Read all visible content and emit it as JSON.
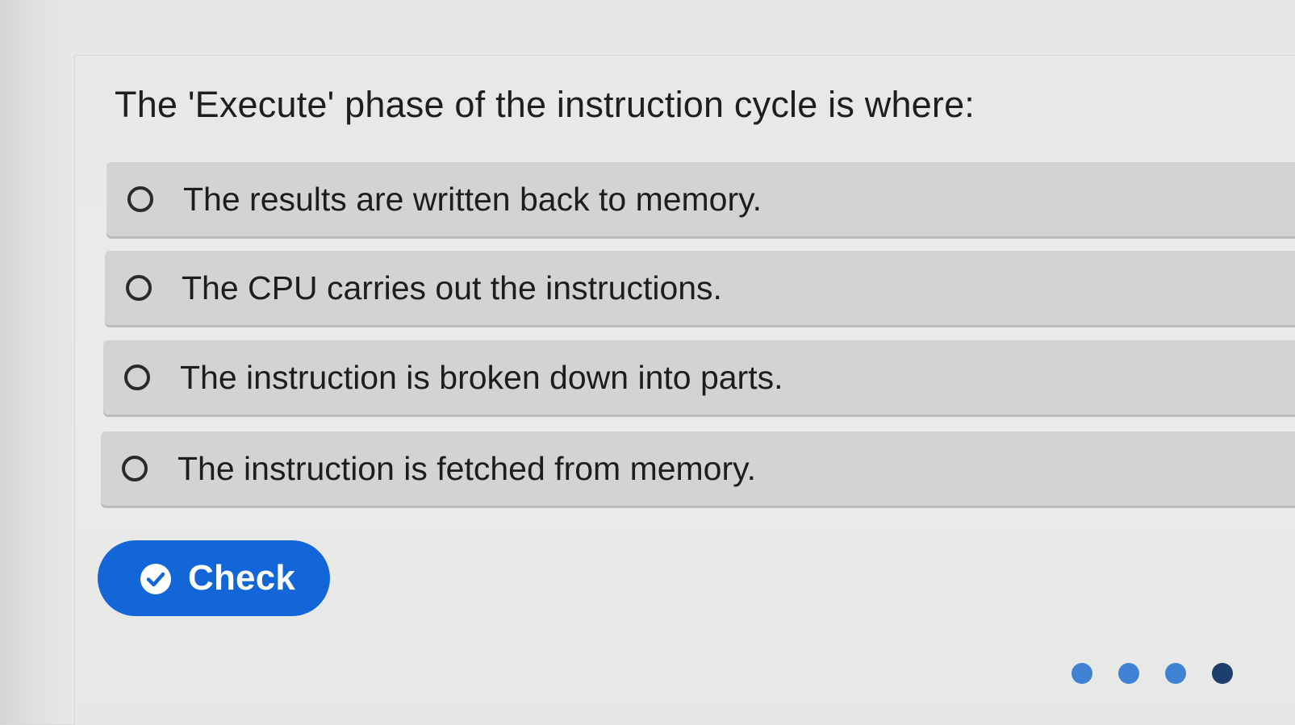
{
  "quiz": {
    "question": "The 'Execute' phase of the instruction cycle is where:",
    "options": [
      {
        "label": "The results are written back to memory.",
        "selected": false
      },
      {
        "label": "The CPU carries out the instructions.",
        "selected": false
      },
      {
        "label": "The instruction is broken down into parts.",
        "selected": false
      },
      {
        "label": "The instruction is fetched from memory.",
        "selected": false
      }
    ],
    "check_button": {
      "label": "Check",
      "icon": "check-circle-icon"
    }
  },
  "pagination": {
    "total": 4,
    "current": 4
  },
  "colors": {
    "primary_button": "#1266d8",
    "option_background": "#d3d3d3",
    "dot_inactive": "#3f82d4",
    "dot_active": "#1d3e6b"
  }
}
